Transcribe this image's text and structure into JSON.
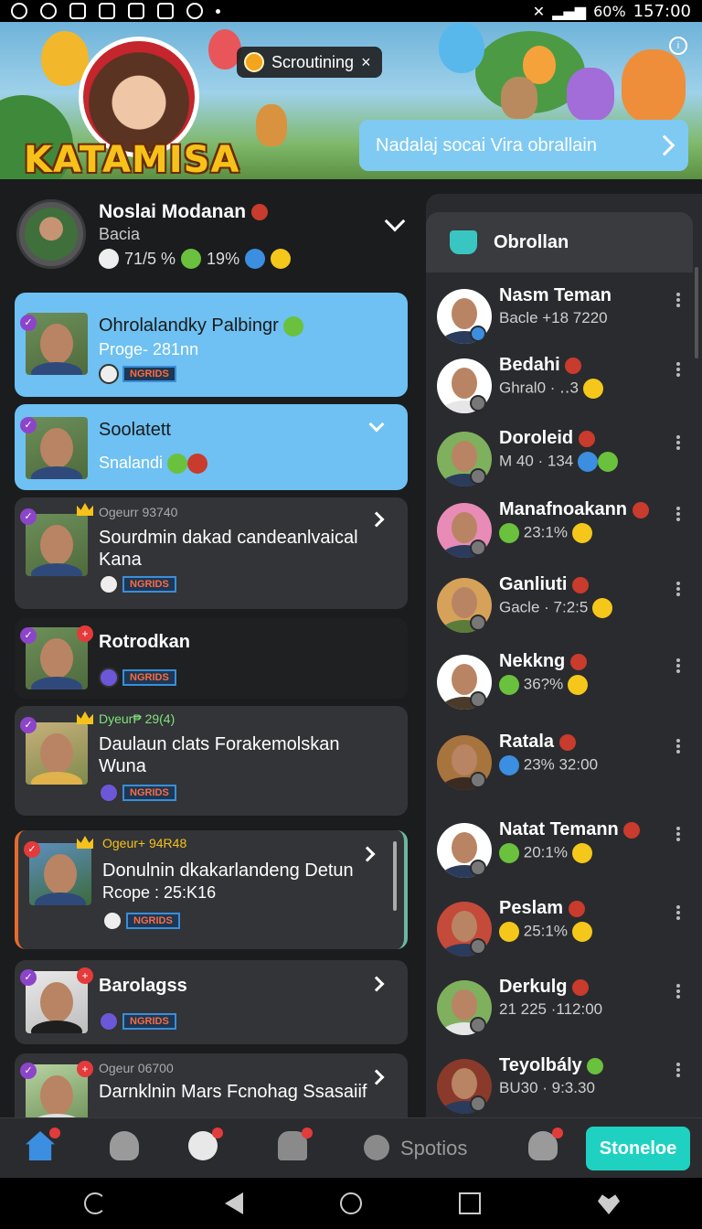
{
  "status_bar": {
    "battery": "60%",
    "time": "157:00"
  },
  "banner": {
    "brand": "KATAMISA",
    "chip_label": "Scroutining",
    "chip_close": "×",
    "cta_text": "Nadalaj socai Vira obrallain"
  },
  "profile": {
    "name": "Noslai Modanan",
    "sub": "Bacia",
    "stat1": "71/5 %",
    "stat2": "19%"
  },
  "cards": [
    {
      "title": "Ohrolalandky Palbingr",
      "sub": "Proge- 281nn",
      "tag": "NGRIDS"
    },
    {
      "title": "Soolatett",
      "sub": "Snalandi"
    },
    {
      "meta": "Ogeurr 93740",
      "title": "Sourdmin dakad candeanlvaical Kana",
      "tag": "NGRIDS"
    },
    {
      "title": "Rotrodkan",
      "tag": "NGRIDS"
    },
    {
      "meta": "Dyeur₱ 29(4)",
      "title": "Daulaun clats Forakemolskan Wuna",
      "tag": "NGRIDS"
    },
    {
      "meta": "Ogeur+ 94R48",
      "title": "Donulnin dkakarlandeng Detun",
      "sub": "Rcope : 25:K16",
      "tag": "NGRIDS"
    },
    {
      "title": "Barolagss",
      "tag": "NGRIDS"
    },
    {
      "meta": "Ogeur 06700",
      "title": "Darnklnin Mars Fcnohag Ssasaiif"
    }
  ],
  "friends_panel": {
    "title": "Obrollan",
    "friends": [
      {
        "name": "Nasm Teman",
        "sub": "Bacle +18 7220"
      },
      {
        "name": "Bedahi",
        "sub": "Ghral0 · ‥3"
      },
      {
        "name": "Doroleid",
        "sub": "M 40 · 134"
      },
      {
        "name": "Manafnoakann",
        "sub": "23:1%"
      },
      {
        "name": "Ganliuti",
        "sub": "Gacle · 7:2:5"
      },
      {
        "name": "Nekkng",
        "sub": "36?%"
      },
      {
        "name": "Ratala",
        "sub": "23% 32:00"
      },
      {
        "name": "Natat Temann",
        "sub": "20:1%"
      },
      {
        "name": "Peslam",
        "sub": "25:1%"
      },
      {
        "name": "Derkulg",
        "sub": "21 225 ·112:00"
      },
      {
        "name": "Teyolbály",
        "sub": "BU30 · 9:3.30"
      }
    ]
  },
  "bottom_nav": {
    "label": "Spotios",
    "button": "Stoneloe"
  },
  "colors": {
    "accent_blue": "#6ec1f2",
    "accent_teal": "#1fd1c1",
    "brand_yellow": "#f6c21a"
  }
}
